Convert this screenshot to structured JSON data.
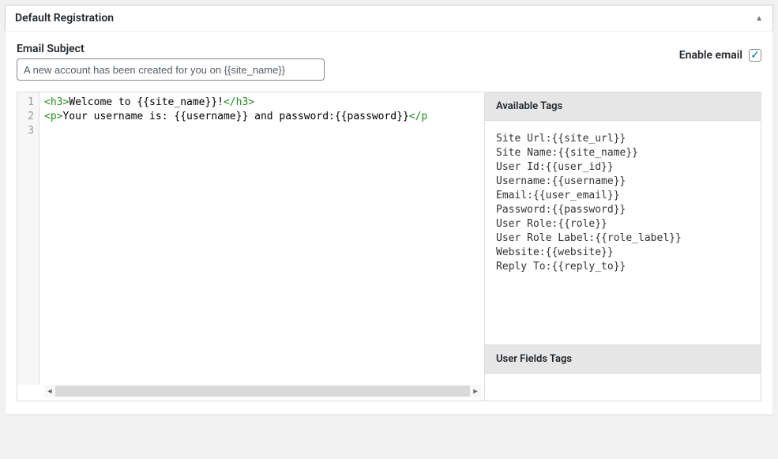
{
  "panel": {
    "title": "Default Registration"
  },
  "subject": {
    "label": "Email Subject",
    "value": "A new account has been created for you on {{site_name}}"
  },
  "enable": {
    "label": "Enable email",
    "checked": true
  },
  "code": {
    "lines_numbers": [
      "1",
      "2",
      "3"
    ],
    "line1_open": "<h3>",
    "line1_text": "Welcome to {{site_name}}!",
    "line1_close": "</h3>",
    "line2_open": "<p>",
    "line2_text": "Your username is: {{username}} and password:{{password}}",
    "line2_close": "</p"
  },
  "tags": {
    "header": "Available Tags",
    "items": [
      "Site Url:{{site_url}}",
      "Site Name:{{site_name}}",
      "User Id:{{user_id}}",
      "Username:{{username}}",
      "Email:{{user_email}}",
      "Password:{{password}}",
      "User Role:{{role}}",
      "User Role Label:{{role_label}}",
      "Website:{{website}}",
      "Reply To:{{reply_to}}"
    ],
    "user_fields_header": "User Fields Tags"
  }
}
